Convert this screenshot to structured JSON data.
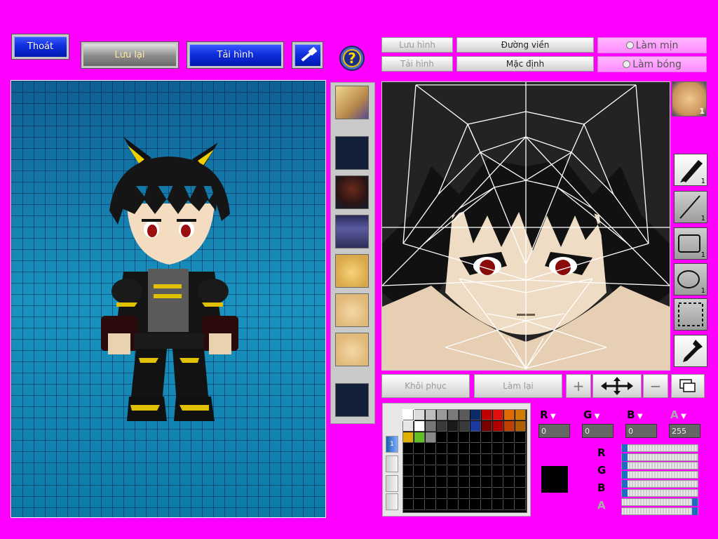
{
  "top_buttons": {
    "exit": "Thoát",
    "save": "Lưu lại",
    "reload": "Tải hình"
  },
  "editor_buttons": {
    "save_image": "Lưu hình",
    "load_image": "Tải hình",
    "outline": "Đường viền",
    "default": "Mặc định",
    "smooth": "Làm mịn",
    "shade": "Làm bóng",
    "restore": "Khôi phục",
    "redo": "Làm lại"
  },
  "tools": {
    "pen_size": "1",
    "line_size": "1",
    "rect_size": "1",
    "ellipse_size": "1"
  },
  "face_badge": "1",
  "color": {
    "labels": {
      "r": "R",
      "g": "G",
      "b": "B",
      "a": "A"
    },
    "r": "0",
    "g": "0",
    "b": "0",
    "a": "255",
    "current": "#000000"
  },
  "palette_page": "1",
  "palette_colors": [
    "#ffffff",
    "#dcdcdc",
    "#bdbdbd",
    "#9a9a9a",
    "#7a7a7a",
    "#5a5a5a",
    "#0b2a6a",
    "#c00000",
    "#e01010",
    "#e06a00",
    "#d07a00",
    "#e6e6e6",
    "#ffffff",
    "#777777",
    "#3a3a3a",
    "#1a1a1a",
    "#3a3a3a",
    "#1a3aa0",
    "#7a0000",
    "#b00000",
    "#c04000",
    "#b06000",
    "#e0b000",
    "#60c020",
    "#888888"
  ]
}
